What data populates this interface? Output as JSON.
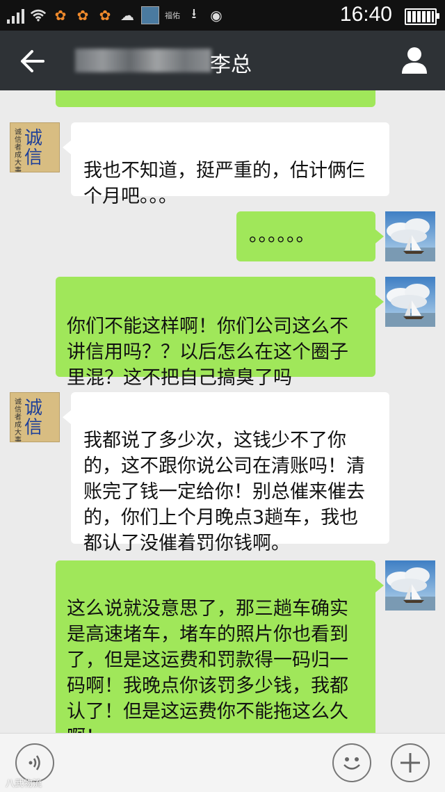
{
  "status_bar": {
    "time": "16:40",
    "notification_text": "福佑",
    "icons": [
      "signal-icon",
      "wifi-icon",
      "app-notification-icon",
      "app-notification-icon",
      "app-notification-icon",
      "weather-icon",
      "app-icon",
      "download-icon",
      "sync-icon",
      "battery-icon"
    ]
  },
  "header": {
    "back_icon": "arrow-left-icon",
    "title_suffix": "李总",
    "profile_icon": "person-icon"
  },
  "messages": [
    {
      "side": "right",
      "text": ""
    },
    {
      "side": "left",
      "text": "我也不知道，挺严重的，估计俩仨\n个月吧。。。"
    },
    {
      "side": "right",
      "text": "。。。。。。"
    },
    {
      "side": "right",
      "text": "你们不能这样啊！你们公司这么不\n讲信用吗？？以后怎么在这个圈子\n里混？这不把自己搞臭了吗"
    },
    {
      "side": "left",
      "text": "我都说了多少次，这钱少不了你\n的，这不跟你说公司在清账吗！清\n账完了钱一定给你！别总催来催去\n的，你们上个月晚点3趟车，我也\n都认了没催着罚你钱啊。"
    },
    {
      "side": "right",
      "text": "这么说就没意思了，那三趟车确实\n是高速堵车，堵车的照片你也看到\n了，但是这运费和罚款得一码归一\n码啊！我晚点你该罚多少钱，我都\n认了！但是这运费你不能拖这么久\n啊！"
    }
  ],
  "contact_avatar": {
    "big_text": "诚信",
    "small_text": "诚信者成大事"
  },
  "input_bar": {
    "voice_icon": "voice-icon",
    "emoji_icon": "emoji-icon",
    "plus_icon": "plus-icon"
  },
  "watermark": "八武物流"
}
